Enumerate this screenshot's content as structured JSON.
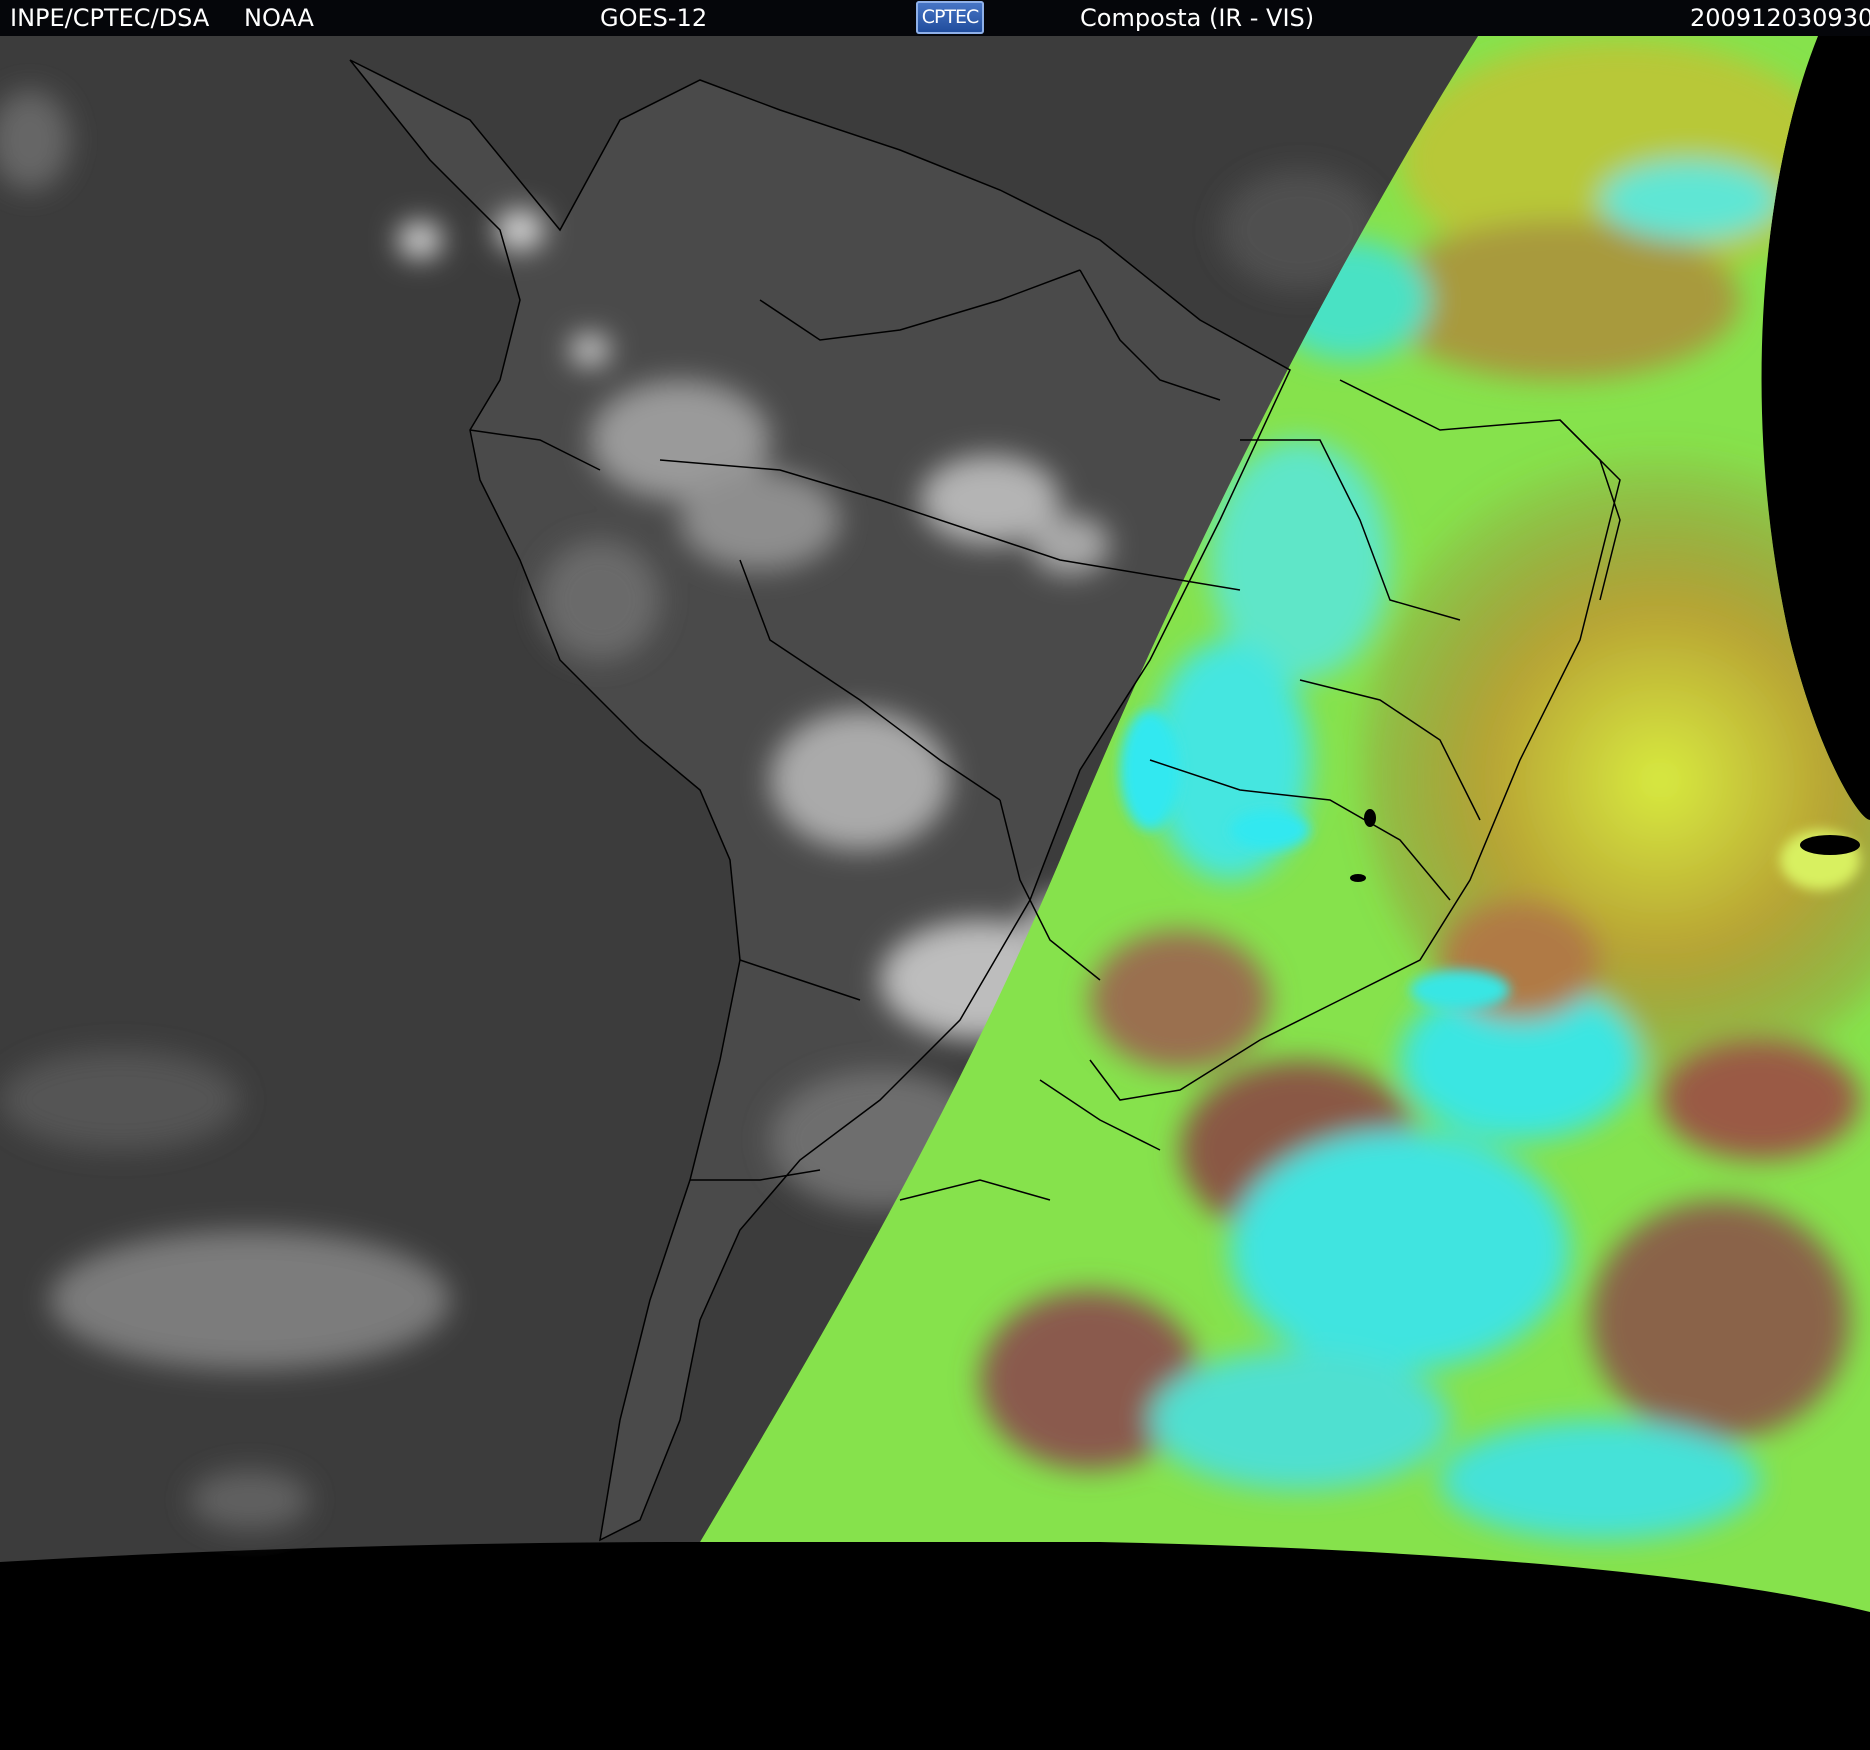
{
  "header": {
    "org": "INPE/CPTEC/DSA",
    "agency": "NOAA",
    "satellite": "GOES-12",
    "logo_text": "CPTEC",
    "product": "Composta (IR - VIS)",
    "timestamp": "200912030930"
  },
  "colors": {
    "header_bg": "#05060a",
    "space": "#000000",
    "ir_ocean": "#3a3a3a",
    "ir_land": "#4a4a4a",
    "ir_cloud": "#c8c8c8",
    "vis_green": "#7ee64a",
    "vis_yellow": "#c8e63a",
    "vis_cyan": "#38e8e0",
    "vis_brown": "#8a5a48",
    "vis_olive": "#b0a030",
    "border": "#000000"
  }
}
